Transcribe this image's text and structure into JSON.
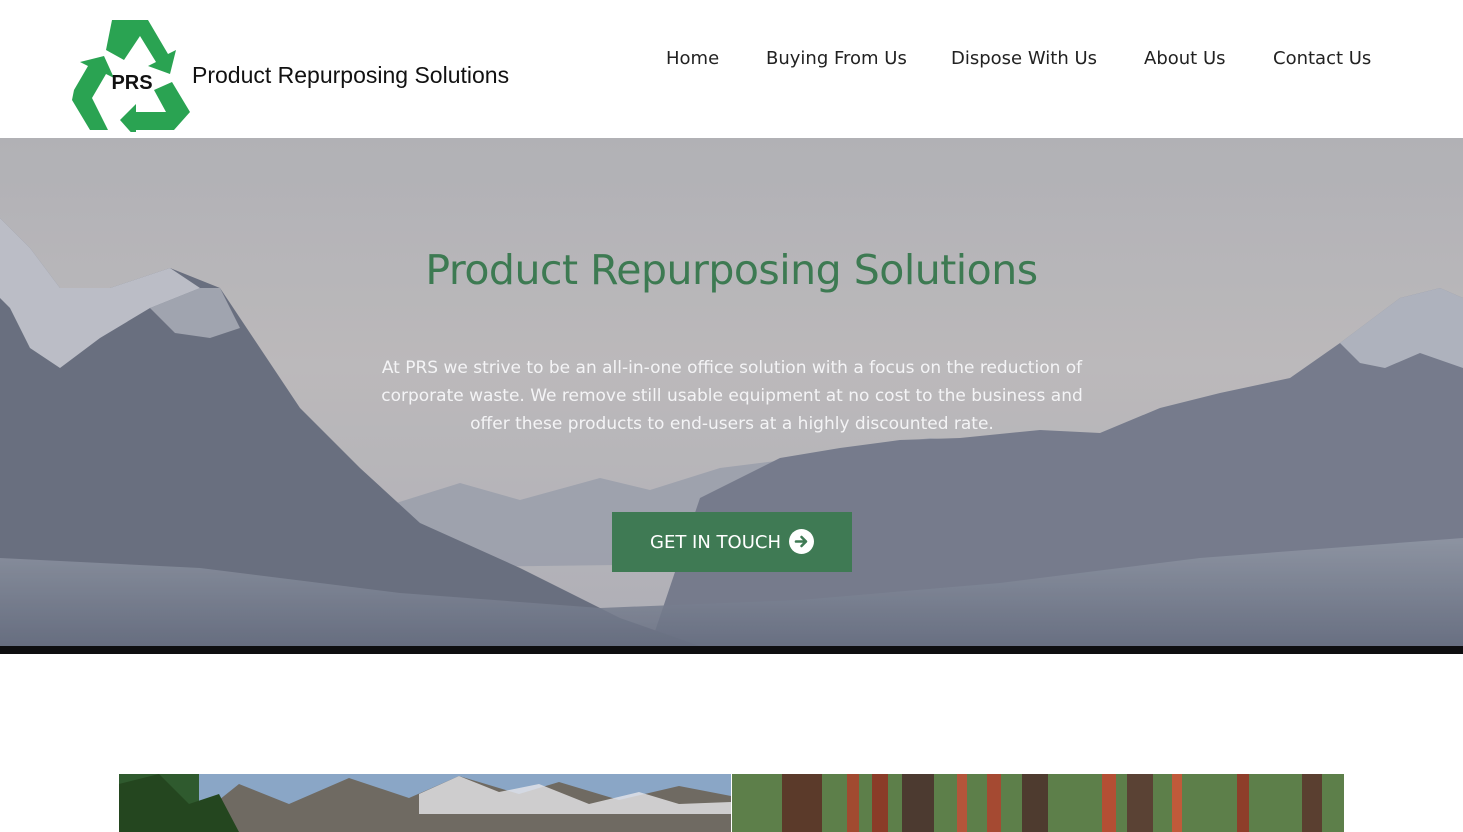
{
  "header": {
    "logo_text": "PRS",
    "brand_name": "Product Repurposing Solutions",
    "nav": [
      {
        "label": "Home"
      },
      {
        "label": "Buying From Us"
      },
      {
        "label": "Dispose With Us"
      },
      {
        "label": "About Us"
      },
      {
        "label": "Contact Us"
      }
    ]
  },
  "hero": {
    "title": "Product Repurposing Solutions",
    "description": "At PRS we strive to be an all-in-one office solution with a focus on the reduction of corporate waste. We remove still usable equipment at no cost to the business and offer these products to end-users at a highly discounted rate.",
    "cta_label": "GET IN TOUCH",
    "cta_icon": "arrow-circle-right-icon"
  },
  "colors": {
    "brand_green": "#3d7a52",
    "logo_green": "#2aa352",
    "button_green": "#3f7a54"
  }
}
